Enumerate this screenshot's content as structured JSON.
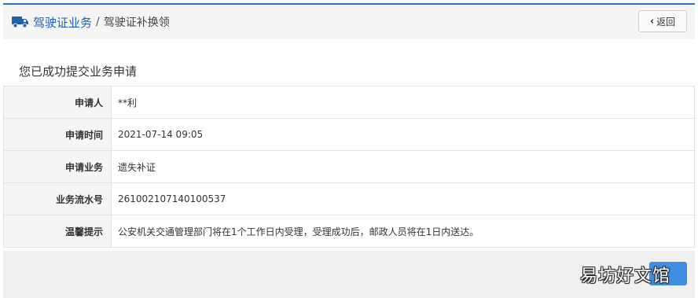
{
  "header": {
    "icon": "truck-icon",
    "breadcrumb_main": "驾驶证业务",
    "breadcrumb_sep": "/",
    "breadcrumb_sub": "驾驶证补换领",
    "back_label": "返回",
    "accent_color": "#2f6fbf"
  },
  "page": {
    "title": "您已成功提交业务申请"
  },
  "details": {
    "rows": [
      {
        "label": "申请人",
        "value": "**利"
      },
      {
        "label": "申请时间",
        "value": "2021-07-14 09:05"
      },
      {
        "label": "申请业务",
        "value": "遗失补证"
      },
      {
        "label": "业务流水号",
        "value": "261002107140100537"
      },
      {
        "label": "温馨提示",
        "value": "公安机关交通管理部门将在1个工作日内受理，受理成功后，邮政人员将在1日内送达。"
      }
    ]
  },
  "footer": {
    "watermark": "易坊好文馆",
    "button_color": "#3d8ee0"
  }
}
